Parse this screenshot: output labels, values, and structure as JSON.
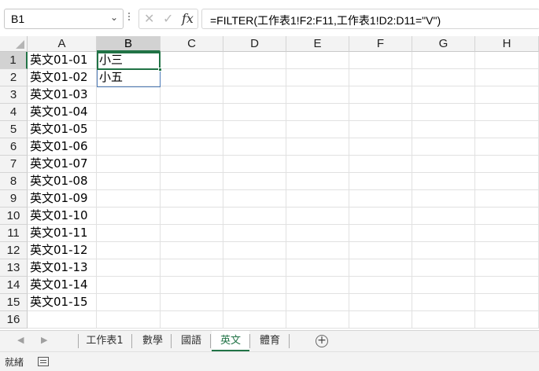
{
  "formula_bar": {
    "name_box": "B1",
    "cancel_symbol": "✕",
    "enter_symbol": "✓",
    "fx_label": "fx",
    "formula": "=FILTER(工作表1!F2:F11,工作表1!D2:D11=\"V\")"
  },
  "grid": {
    "columns": [
      "A",
      "B",
      "C",
      "D",
      "E",
      "F",
      "G",
      "H"
    ],
    "selected_column": "B",
    "rows": [
      "1",
      "2",
      "3",
      "4",
      "5",
      "6",
      "7",
      "8",
      "9",
      "10",
      "11",
      "12",
      "13",
      "14",
      "15",
      "16"
    ],
    "selected_row": "1",
    "active_cell": "B1",
    "column_A": [
      "英文01-01",
      "英文01-02",
      "英文01-03",
      "英文01-04",
      "英文01-05",
      "英文01-06",
      "英文01-07",
      "英文01-08",
      "英文01-09",
      "英文01-10",
      "英文01-11",
      "英文01-12",
      "英文01-13",
      "英文01-14",
      "英文01-15"
    ],
    "column_B": [
      "小三",
      "小五"
    ]
  },
  "sheet_tabs": {
    "tabs": [
      "工作表1",
      "數學",
      "國語",
      "英文",
      "體育"
    ],
    "active": "英文",
    "add_symbol": "+"
  },
  "status_bar": {
    "text": "就緒"
  },
  "colors": {
    "accent": "#217346",
    "header_bg": "#f3f3f3",
    "selected_header_bg": "#d2d2d2",
    "spill_border": "#4c7ab8"
  }
}
